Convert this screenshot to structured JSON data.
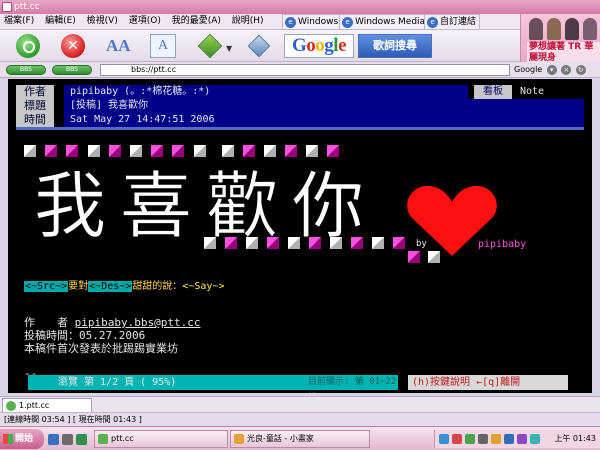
{
  "window": {
    "title": "ptt.cc"
  },
  "menu": {
    "items": [
      "檔案(F)",
      "編輯(E)",
      "檢視(V)",
      "選項(O)",
      "我的最愛(A)",
      "說明(H)"
    ],
    "links": [
      "Windows",
      "Windows Media",
      "自訂連結"
    ]
  },
  "toolbar": {
    "font_large_glyph": "AA",
    "font_select_glyph": "A",
    "google_label": [
      "G",
      "o",
      "o",
      "g",
      "l",
      "e"
    ],
    "lyrics_label": "歌詞搜尋",
    "ad_text": "夢想讓著 TR 華麗現身"
  },
  "address": {
    "value": "bbs://ptt.cc",
    "pill_left": "BBS",
    "pill_right": "BBS",
    "search_engine": "Google"
  },
  "article": {
    "header_labels": [
      "作者",
      "標題",
      "時間"
    ],
    "author": "pipibaby (。:*棉花糖。:*)",
    "title": "[投稿] 我喜歡你",
    "time": "Sat May 27 14:47:51 2006",
    "board_tag": "看板",
    "board_name": "Note",
    "art_text": "我喜歡你",
    "by_text": "by",
    "art_signature": "pipibaby",
    "ansi_line": {
      "src": "<~Src~>",
      "mid1": "要對",
      "des": "<~Des~>",
      "mid2": "甜甜的說：",
      "say": "<~Say~>"
    },
    "footer": {
      "author_label": "作　　者",
      "author_email": "pipibaby.bbs@ptt.cc",
      "post_time": "投稿時間：05.27.2006",
      "origin": "本稿件首次發表於批踢踢實業坊"
    },
    "divider": "--"
  },
  "status_bar": {
    "browse": "瀏覽 第 1/2 頁 ( 95%)",
    "showing": "目前顯示: 第 01~22 行",
    "help": "(h)按鍵說明",
    "leave": "←[q]離開"
  },
  "tabs": [
    {
      "label": "1.ptt.cc"
    }
  ],
  "connection": {
    "text": "[連線時間 03:54 ] [ 現在時間 01:43 ]"
  },
  "taskbar": {
    "start_label": "開始",
    "tasks": [
      "ptt.cc",
      "光良-童話 - 小畫家"
    ],
    "clock": "上午 01:43"
  }
}
